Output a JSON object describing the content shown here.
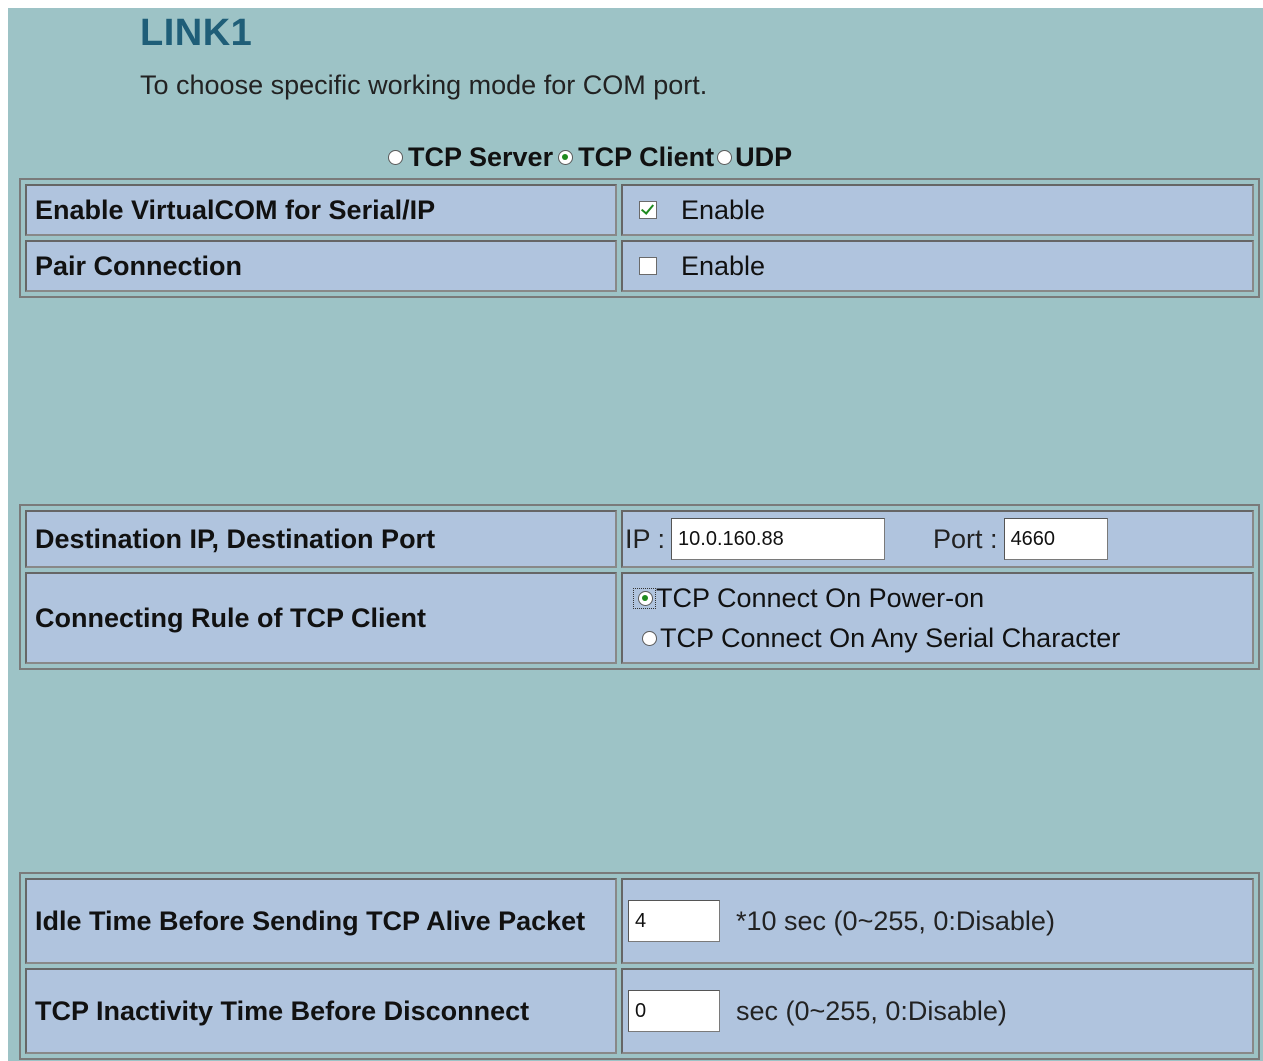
{
  "header": {
    "title": "LINK1",
    "subtitle": "To choose specific working mode for COM port."
  },
  "mode_selector": {
    "options": [
      {
        "label": "TCP Server",
        "selected": false
      },
      {
        "label": "TCP Client",
        "selected": true
      },
      {
        "label": "UDP",
        "selected": false
      }
    ]
  },
  "section1": {
    "rows": [
      {
        "label": "Enable VirtualCOM for Serial/IP",
        "checkbox_label": "Enable",
        "checked": true
      },
      {
        "label": "Pair Connection",
        "checkbox_label": "Enable",
        "checked": false
      }
    ]
  },
  "section2": {
    "destination": {
      "label": "Destination IP, Destination Port",
      "ip_label": "IP :",
      "ip_value": "10.0.160.88",
      "port_label": "Port :",
      "port_value": "4660"
    },
    "connecting_rule": {
      "label": "Connecting Rule of TCP Client",
      "options": [
        {
          "label": "TCP Connect On Power-on",
          "selected": true
        },
        {
          "label": "TCP Connect On Any Serial Character",
          "selected": false
        }
      ]
    }
  },
  "section3": {
    "idle_time": {
      "label": "Idle Time Before Sending TCP Alive Packet",
      "value": "4",
      "unit": "*10 sec (0~255, 0:Disable)"
    },
    "inactivity_time": {
      "label": "TCP Inactivity Time Before Disconnect",
      "value": "0",
      "unit": "sec (0~255, 0:Disable)"
    }
  },
  "colors": {
    "page_bg": "#9dc3c6",
    "cell_bg": "#b0c4de",
    "title": "#1f5e78",
    "selected_mark": "#1e8a1e"
  }
}
